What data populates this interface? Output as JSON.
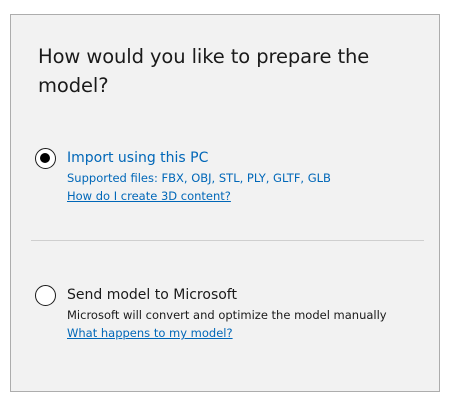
{
  "dialog": {
    "title": "How would you like to prepare the model?",
    "options": [
      {
        "label": "Import using this PC",
        "description": "Supported files: FBX, OBJ, STL, PLY, GLTF, GLB",
        "link": "How do I create 3D content?",
        "selected": true
      },
      {
        "label": "Send model to Microsoft",
        "description": "Microsoft will convert and optimize the model manually",
        "link": "What happens to my model?",
        "selected": false
      }
    ]
  },
  "colors": {
    "accent": "#0067b8",
    "background": "#f2f2f2",
    "border": "#adadad",
    "text": "#1a1a1a",
    "divider": "#cfcfcf"
  },
  "icons": {
    "radio_selected": "radio-selected-icon",
    "radio_unselected": "radio-unselected-icon"
  }
}
